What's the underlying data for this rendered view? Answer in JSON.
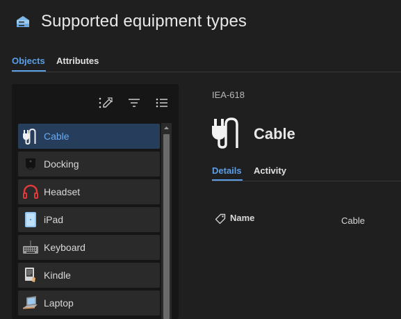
{
  "header": {
    "title": "Supported equipment types",
    "icon": "server-icon"
  },
  "tabs": [
    {
      "label": "Objects",
      "active": true
    },
    {
      "label": "Attributes",
      "active": false
    }
  ],
  "toolbar": {
    "icons": [
      "edit-list-icon",
      "filter-icon",
      "list-icon"
    ]
  },
  "list": {
    "items": [
      {
        "label": "Cable",
        "icon": "cable-icon",
        "selected": true
      },
      {
        "label": "Docking",
        "icon": "docking-icon",
        "selected": false
      },
      {
        "label": "Headset",
        "icon": "headset-icon",
        "selected": false
      },
      {
        "label": "iPad",
        "icon": "ipad-icon",
        "selected": false
      },
      {
        "label": "Keyboard",
        "icon": "keyboard-icon",
        "selected": false
      },
      {
        "label": "Kindle",
        "icon": "kindle-icon",
        "selected": false
      },
      {
        "label": "Laptop",
        "icon": "laptop-icon",
        "selected": false
      }
    ]
  },
  "detail": {
    "id": "IEA-618",
    "title": "Cable",
    "icon": "cable-icon",
    "tabs": [
      {
        "label": "Details",
        "active": true
      },
      {
        "label": "Activity",
        "active": false
      }
    ],
    "attributes": [
      {
        "name": "Name",
        "value": "Cable",
        "icon": "tag-icon"
      }
    ]
  },
  "colors": {
    "accent": "#5b9fe8",
    "selected_bg": "#263d5c",
    "background": "#1f1f1f",
    "panel": "#161616",
    "item_bg": "#2a2a2b"
  }
}
